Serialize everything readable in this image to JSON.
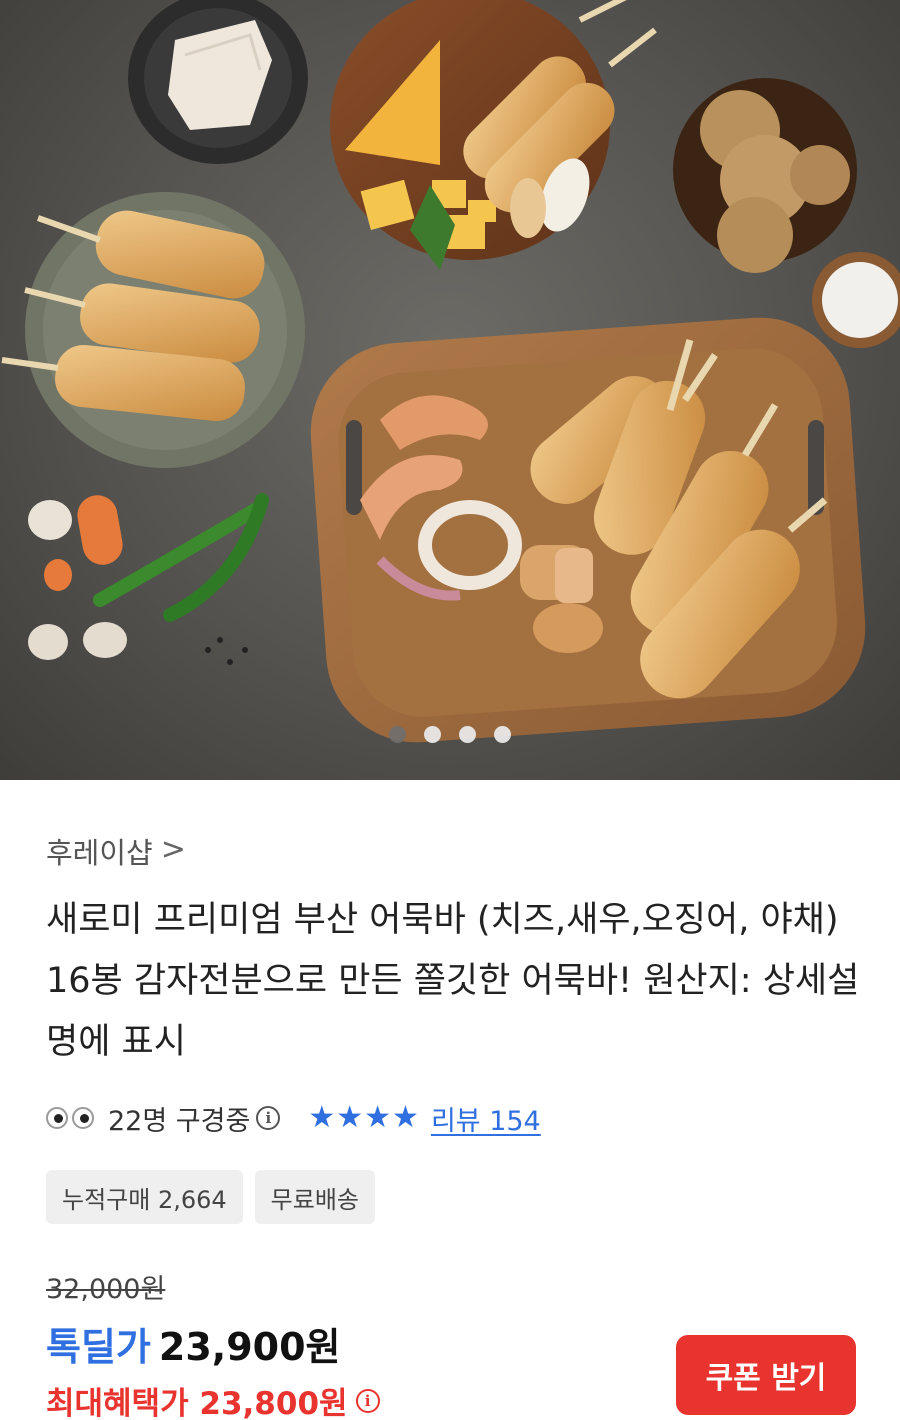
{
  "gallery": {
    "image_label": "어묵바 상품 이미지",
    "page_count": 4,
    "active_index": 0
  },
  "product": {
    "seller": "후레이샵",
    "seller_chevron": ">",
    "title": "새로미 프리미엄 부산 어묵바 (치즈,새우,오징어, 야채) 16봉 감자전분으로 만든 쫄깃한 어묵바! 원산지: 상세설명에 표시",
    "viewing": "22명 구경중",
    "rating_stars": 4,
    "review": "리뷰 154",
    "chips": [
      "누적구매 2,664",
      "무료배송"
    ]
  },
  "price": {
    "original": "32,000원",
    "deal_label": "톡딜가",
    "deal_price": "23,900원",
    "max_benefit": "최대혜택가 23,800원"
  },
  "actions": {
    "coupon_button": "쿠폰 받기"
  },
  "colors": {
    "accent_blue": "#2f6fe0",
    "accent_red": "#e8332f"
  },
  "icons": {
    "info": "info-circle-icon",
    "star": "star-icon",
    "eyes": "eyes-icon"
  }
}
